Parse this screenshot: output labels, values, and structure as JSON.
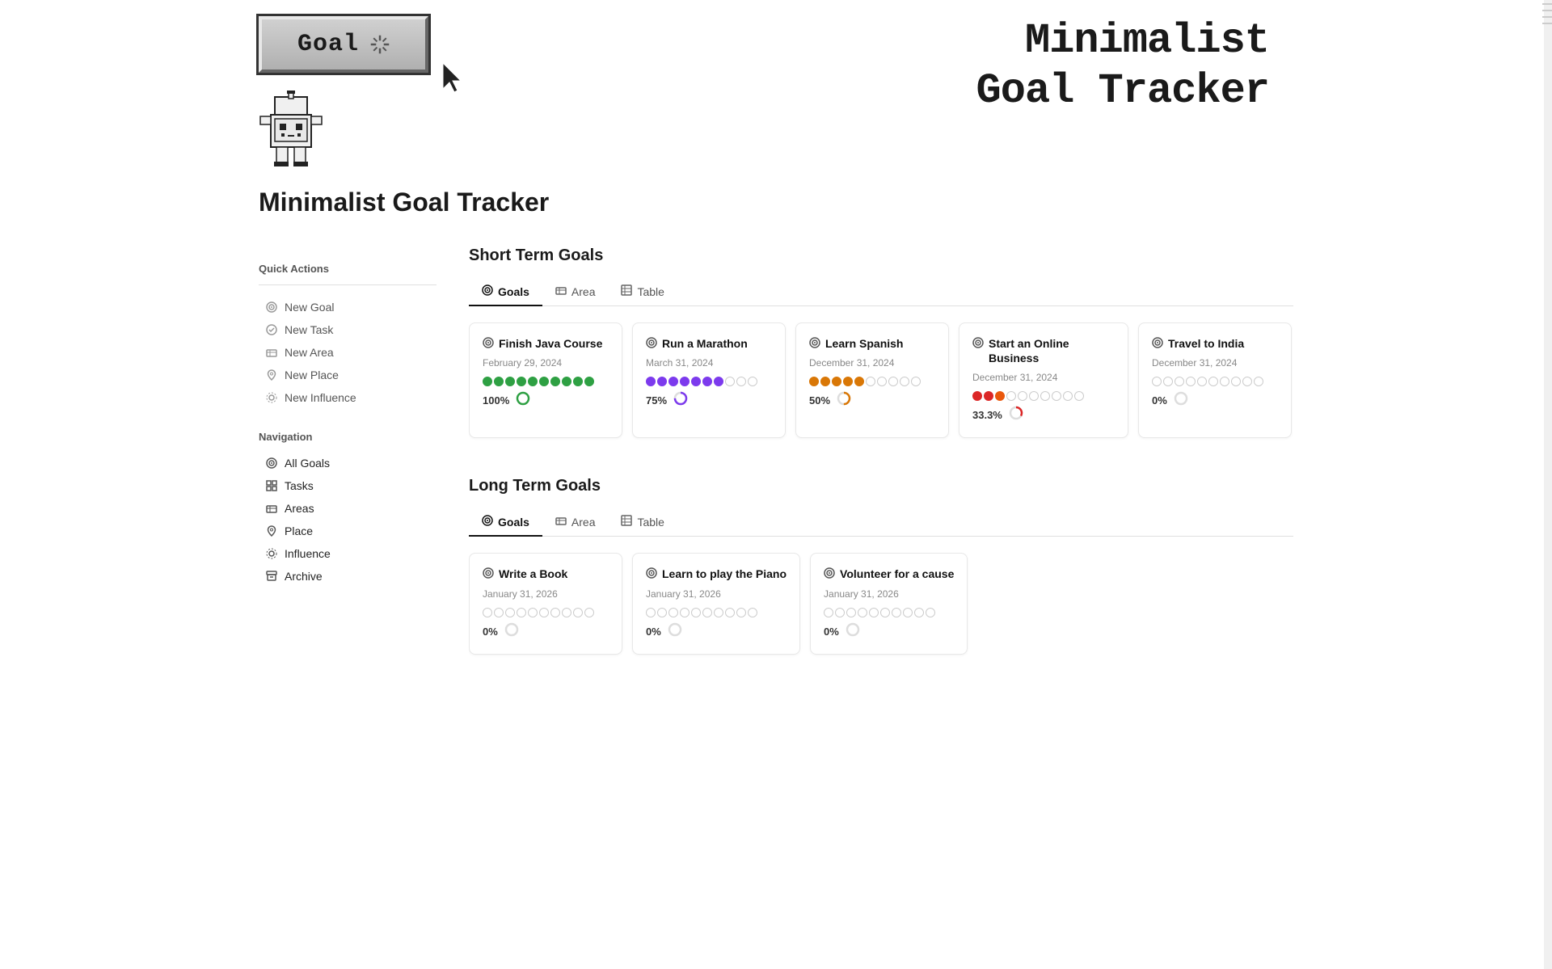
{
  "header": {
    "pixel_button_text": "Goal",
    "page_title_large_line1": "Minimalist",
    "page_title_large_line2": "Goal Tracker",
    "page_title": "Minimalist Goal Tracker"
  },
  "quick_actions": {
    "title": "Quick Actions",
    "items": [
      {
        "id": "new-goal",
        "label": "New Goal",
        "icon": "goal"
      },
      {
        "id": "new-task",
        "label": "New Task",
        "icon": "task"
      },
      {
        "id": "new-area",
        "label": "New Area",
        "icon": "area"
      },
      {
        "id": "new-place",
        "label": "New Place",
        "icon": "place"
      },
      {
        "id": "new-influence",
        "label": "New Influence",
        "icon": "influence"
      }
    ]
  },
  "navigation": {
    "title": "Navigation",
    "items": [
      {
        "id": "all-goals",
        "label": "All Goals",
        "icon": "goal"
      },
      {
        "id": "tasks",
        "label": "Tasks",
        "icon": "task"
      },
      {
        "id": "areas",
        "label": "Areas",
        "icon": "area"
      },
      {
        "id": "place",
        "label": "Place",
        "icon": "place"
      },
      {
        "id": "influence",
        "label": "Influence",
        "icon": "influence"
      },
      {
        "id": "archive",
        "label": "Archive",
        "icon": "archive"
      }
    ]
  },
  "short_term": {
    "title": "Short Term Goals",
    "tabs": [
      {
        "id": "goals",
        "label": "Goals",
        "icon": "goal",
        "active": true
      },
      {
        "id": "area",
        "label": "Area",
        "icon": "area",
        "active": false
      },
      {
        "id": "table",
        "label": "Table",
        "icon": "table",
        "active": false
      }
    ],
    "cards": [
      {
        "title": "Finish Java Course",
        "date": "February 29, 2024",
        "progress_pct": "100%",
        "dots": [
          "filled-green",
          "filled-green",
          "filled-green",
          "filled-green",
          "filled-green",
          "filled-green",
          "filled-green",
          "filled-green",
          "filled-green",
          "filled-green"
        ],
        "spinner_type": "full-green"
      },
      {
        "title": "Run a Marathon",
        "date": "March 31, 2024",
        "progress_pct": "75%",
        "dots": [
          "filled-purple",
          "filled-purple",
          "filled-purple",
          "filled-purple",
          "filled-purple",
          "filled-purple",
          "filled-purple",
          "empty",
          "empty",
          "empty"
        ],
        "spinner_type": "partial-75"
      },
      {
        "title": "Learn Spanish",
        "date": "December 31, 2024",
        "progress_pct": "50%",
        "dots": [
          "filled-yellow",
          "filled-yellow",
          "filled-yellow",
          "filled-yellow",
          "filled-yellow",
          "empty",
          "empty",
          "empty",
          "empty",
          "empty"
        ],
        "spinner_type": "partial-50"
      },
      {
        "title": "Start an Online Business",
        "date": "December 31, 2024",
        "progress_pct": "33.3%",
        "dots": [
          "filled-red",
          "filled-red",
          "filled-orange",
          "empty",
          "empty",
          "empty",
          "empty",
          "empty",
          "empty",
          "empty"
        ],
        "spinner_type": "partial-33"
      },
      {
        "title": "Travel to India",
        "date": "December 31, 2024",
        "progress_pct": "0%",
        "dots": [
          "empty",
          "empty",
          "empty",
          "empty",
          "empty",
          "empty",
          "empty",
          "empty",
          "empty",
          "empty"
        ],
        "spinner_type": "empty"
      }
    ]
  },
  "long_term": {
    "title": "Long Term Goals",
    "tabs": [
      {
        "id": "goals",
        "label": "Goals",
        "icon": "goal",
        "active": true
      },
      {
        "id": "area",
        "label": "Area",
        "icon": "area",
        "active": false
      },
      {
        "id": "table",
        "label": "Table",
        "icon": "table",
        "active": false
      }
    ],
    "cards": [
      {
        "title": "Write a Book",
        "date": "January 31, 2026",
        "progress_pct": "0%",
        "dots": [
          "empty",
          "empty",
          "empty",
          "empty",
          "empty",
          "empty",
          "empty",
          "empty",
          "empty",
          "empty"
        ],
        "spinner_type": "empty"
      },
      {
        "title": "Learn to play the Piano",
        "date": "January 31, 2026",
        "progress_pct": "0%",
        "dots": [
          "empty",
          "empty",
          "empty",
          "empty",
          "empty",
          "empty",
          "empty",
          "empty",
          "empty",
          "empty"
        ],
        "spinner_type": "empty"
      },
      {
        "title": "Volunteer for a cause",
        "date": "January 31, 2026",
        "progress_pct": "0%",
        "dots": [
          "empty",
          "empty",
          "empty",
          "empty",
          "empty",
          "empty",
          "empty",
          "empty",
          "empty",
          "empty"
        ],
        "spinner_type": "empty"
      }
    ]
  }
}
